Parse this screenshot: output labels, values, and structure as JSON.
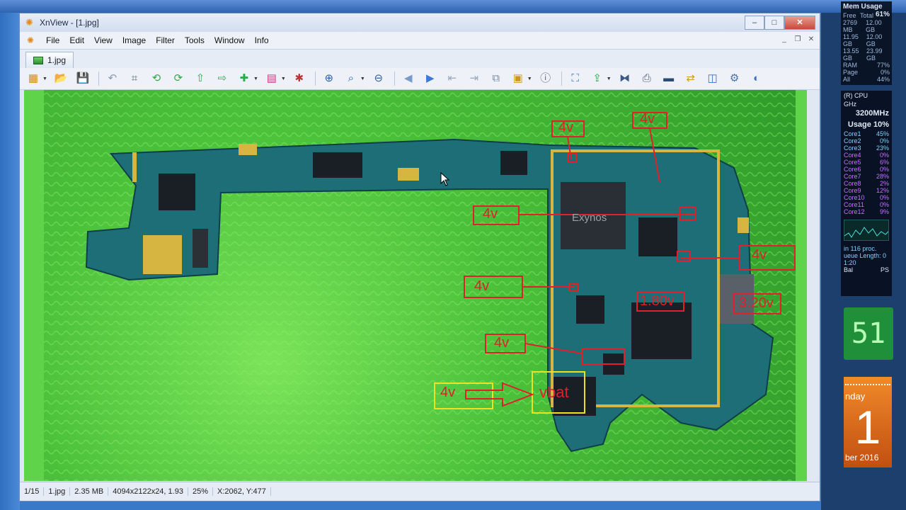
{
  "window": {
    "title": "XnView - [1.jpg]",
    "controls": {
      "minimize": "–",
      "maximize": "□",
      "close": "✕"
    }
  },
  "menu": [
    "File",
    "Edit",
    "View",
    "Image",
    "Filter",
    "Tools",
    "Window",
    "Info"
  ],
  "tab": {
    "label": "1.jpg"
  },
  "toolbar": {
    "icons": [
      "browser-icon",
      "open-folder-icon",
      "save-icon",
      "undo-icon",
      "crop-icon",
      "rotate-left-icon",
      "rotate-right-icon",
      "previous-folder-icon",
      "next-folder-icon",
      "acquire-icon",
      "adjust-icon",
      "effects-icon",
      "zoom-in-icon",
      "zoom-icon",
      "zoom-out-icon",
      "previous-image-icon",
      "next-image-icon",
      "first-image-icon",
      "last-image-icon",
      "copy-to-icon",
      "slideshow-icon",
      "properties-icon",
      "fullscreen-icon",
      "export-icon",
      "compare-icon",
      "print-icon",
      "scan-icon",
      "convert-icon",
      "capture-icon",
      "options-icon",
      "help-icon"
    ]
  },
  "annotations": {
    "a1": "4v",
    "a2": "4v",
    "a3": "4v",
    "a4": "4v",
    "a5": "4v",
    "a6": "1.80v",
    "a7": "3.20v",
    "a8": "4v",
    "a9": "4v",
    "vbat": "vbat",
    "chip_logo": "Exynos"
  },
  "statusbar": {
    "index": "1/15",
    "filename": "1.jpg",
    "filesize": "2.35 MB",
    "dimensions": "4094x2122x24, 1.93",
    "zoom": "25%",
    "coords": "X:2062, Y:477"
  },
  "gadgets": {
    "mem": {
      "title": "Mem Usage",
      "percent": "61%",
      "col1": "Free",
      "col2": "Total",
      "rows": [
        {
          "free": "2769 MB",
          "total": "12.00 GB"
        },
        {
          "free": "11.95 GB",
          "total": "12.00 GB"
        },
        {
          "free": "13.55 GB",
          "total": "23.99 GB"
        }
      ],
      "ram_label": "RAM",
      "ram_value": "77%",
      "page_label": "Page",
      "page_value": "0%",
      "all_label": "All",
      "all_value": "44%"
    },
    "cpu": {
      "name": "(R) CPU",
      "ghz": "GHz",
      "mhz": "3200MHz",
      "usage_label": "Usage",
      "usage_value": "10%",
      "cores": [
        {
          "n": "Core1",
          "v": "45%"
        },
        {
          "n": "Core2",
          "v": "0%"
        },
        {
          "n": "Core3",
          "v": "23%"
        },
        {
          "n": "Core4",
          "v": "0%"
        },
        {
          "n": "Core5",
          "v": "6%"
        },
        {
          "n": "Core6",
          "v": "0%"
        },
        {
          "n": "Core7",
          "v": "28%"
        },
        {
          "n": "Core8",
          "v": "2%"
        },
        {
          "n": "Core9",
          "v": "12%"
        },
        {
          "n": "Core10",
          "v": "0%"
        },
        {
          "n": "Core11",
          "v": "0%"
        },
        {
          "n": "Core12",
          "v": "9%"
        }
      ],
      "proc": "in 116 proc.",
      "queue": "ueue Length: 0",
      "time": "1:20",
      "bal": "Bal",
      "ps": "PS"
    },
    "clock": {
      "display": "51"
    },
    "calendar": {
      "day_name": "nday",
      "day": "1",
      "month": "ber 2016"
    }
  },
  "colors": {
    "accent_red": "#e0202a",
    "accent_yellow": "#f0e020",
    "board": "#1e6e78",
    "background": "#5fd34a"
  }
}
